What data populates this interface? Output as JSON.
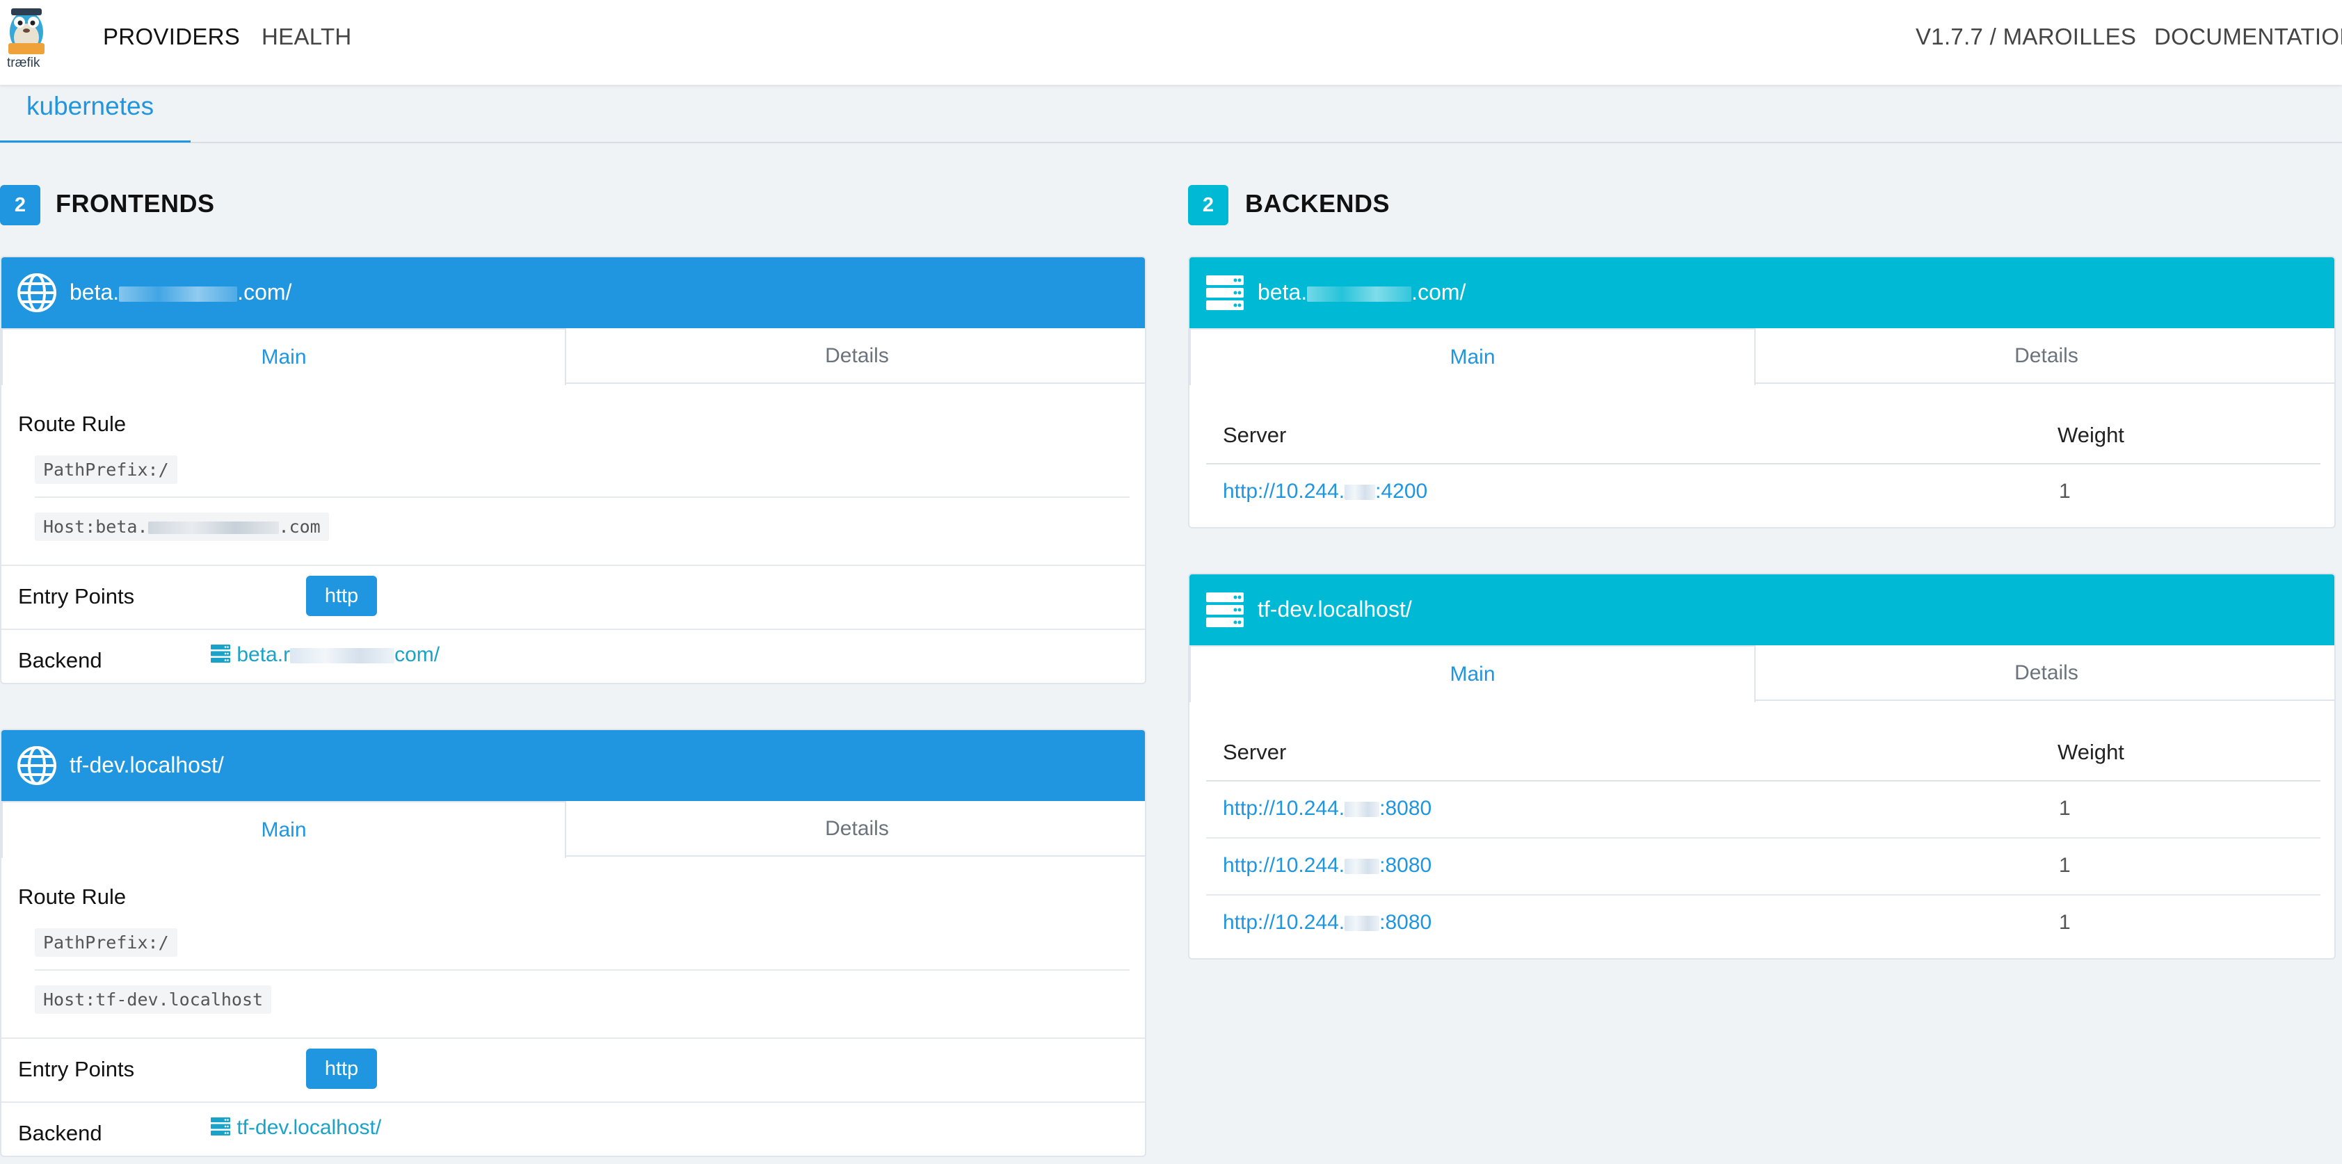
{
  "nav": {
    "logo_alt": "træfik",
    "providers": "PROVIDERS",
    "health": "HEALTH",
    "version": "V1.7.7 / MAROILLES",
    "docs": "DOCUMENTATION"
  },
  "provider_tab": "kubernetes",
  "frontends": {
    "count": "2",
    "title": "FRONTENDS",
    "items": [
      {
        "name_prefix": "beta.",
        "name_suffix": ".com/",
        "tab_main": "Main",
        "tab_details": "Details",
        "route_rule_label": "Route Rule",
        "rule_path": "PathPrefix:/",
        "rule_host_prefix": "Host:beta.",
        "rule_host_suffix": ".com",
        "entry_points_label": "Entry Points",
        "entry_point": "http",
        "backend_label": "Backend",
        "backend_prefix": "beta.r",
        "backend_suffix": "com/"
      },
      {
        "name": "tf-dev.localhost/",
        "tab_main": "Main",
        "tab_details": "Details",
        "route_rule_label": "Route Rule",
        "rule_path": "PathPrefix:/",
        "rule_host": "Host:tf-dev.localhost",
        "entry_points_label": "Entry Points",
        "entry_point": "http",
        "backend_label": "Backend",
        "backend": "tf-dev.localhost/"
      }
    ]
  },
  "backends": {
    "count": "2",
    "title": "BACKENDS",
    "items": [
      {
        "name_prefix": "beta.",
        "name_suffix": ".com/",
        "tab_main": "Main",
        "tab_details": "Details",
        "col_server": "Server",
        "col_weight": "Weight",
        "servers": [
          {
            "prefix": "http://10.244.",
            "suffix": ":4200",
            "weight": "1"
          }
        ]
      },
      {
        "name": "tf-dev.localhost/",
        "tab_main": "Main",
        "tab_details": "Details",
        "col_server": "Server",
        "col_weight": "Weight",
        "servers": [
          {
            "prefix": "http://10.244.",
            "suffix": ":8080",
            "weight": "1"
          },
          {
            "prefix": "http://10.244.",
            "suffix": ":8080",
            "weight": "1"
          },
          {
            "prefix": "http://10.244.",
            "suffix": ":8080",
            "weight": "1"
          }
        ]
      }
    ]
  },
  "colors": {
    "frontend_header": "#2196e0",
    "backend_header": "#00b9d4",
    "frontend_badge": "#2196e0",
    "backend_badge": "#00b9d4",
    "link_blue": "#2196e0",
    "link_cyan": "#1aa3c9"
  }
}
